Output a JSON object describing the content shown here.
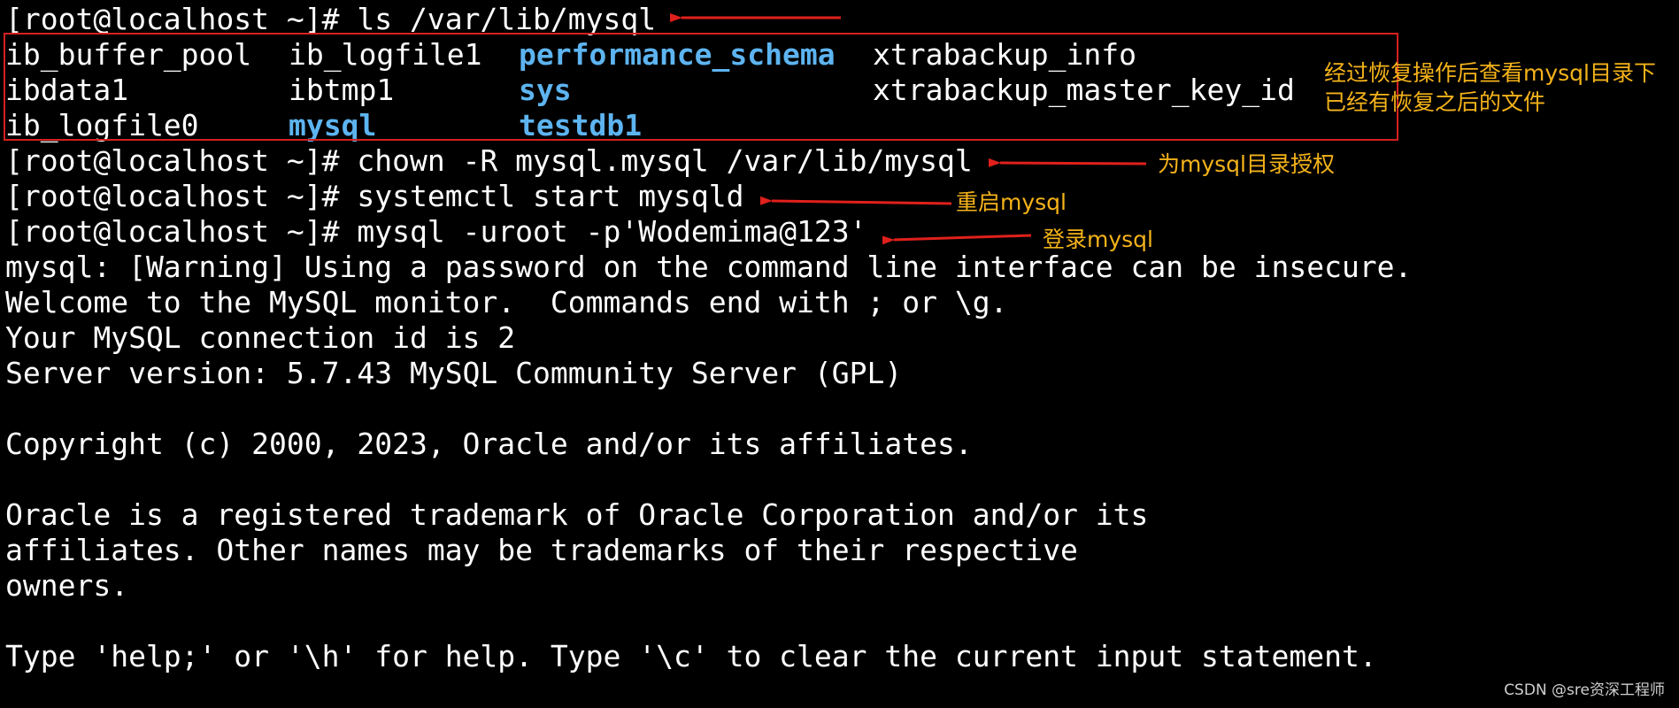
{
  "colors": {
    "background": "#000000",
    "text": "#ffffff",
    "directory": "#5db4f0",
    "annotation": "#f5b31a",
    "arrow": "#e0201b",
    "box": "#d62020"
  },
  "terminal": {
    "prompt": "[root@localhost ~]#",
    "commands": {
      "ls": "ls /var/lib/mysql",
      "chown": "chown -R mysql.mysql /var/lib/mysql",
      "start": "systemctl start mysqld",
      "login": "mysql -uroot -p'Wodemima@123'"
    },
    "listing": [
      [
        {
          "name": "ib_buffer_pool",
          "type": "file"
        },
        {
          "name": "ib_logfile1",
          "type": "file"
        },
        {
          "name": "performance_schema",
          "type": "directory"
        },
        {
          "name": "xtrabackup_info",
          "type": "file"
        }
      ],
      [
        {
          "name": "ibdata1",
          "type": "file"
        },
        {
          "name": "ibtmp1",
          "type": "file"
        },
        {
          "name": "sys",
          "type": "directory"
        },
        {
          "name": "xtrabackup_master_key_id",
          "type": "file"
        }
      ],
      [
        {
          "name": "ib_logfile0",
          "type": "file"
        },
        {
          "name": "mysql",
          "type": "directory"
        },
        {
          "name": "testdb1",
          "type": "directory"
        }
      ]
    ],
    "output": {
      "warning": "mysql: [Warning] Using a password on the command line interface can be insecure.",
      "welcome": "Welcome to the MySQL monitor.  Commands end with ; or \\g.",
      "connection": "Your MySQL connection id is 2",
      "server_version": "Server version: 5.7.43 MySQL Community Server (GPL)",
      "copyright": "Copyright (c) 2000, 2023, Oracle and/or its affiliates.",
      "trademark_1": "Oracle is a registered trademark of Oracle Corporation and/or its",
      "trademark_2": "affiliates. Other names may be trademarks of their respective",
      "trademark_3": "owners.",
      "help": "Type 'help;' or '\\h' for help. Type '\\c' to clear the current input statement."
    }
  },
  "annotations": {
    "restore_line1": "经过恢复操作后查看mysql目录下",
    "restore_line2": "已经有恢复之后的文件",
    "chown": "为mysql目录授权",
    "restart": "重启mysql",
    "login": "登录mysql"
  },
  "watermark": "CSDN @sre资深工程师"
}
